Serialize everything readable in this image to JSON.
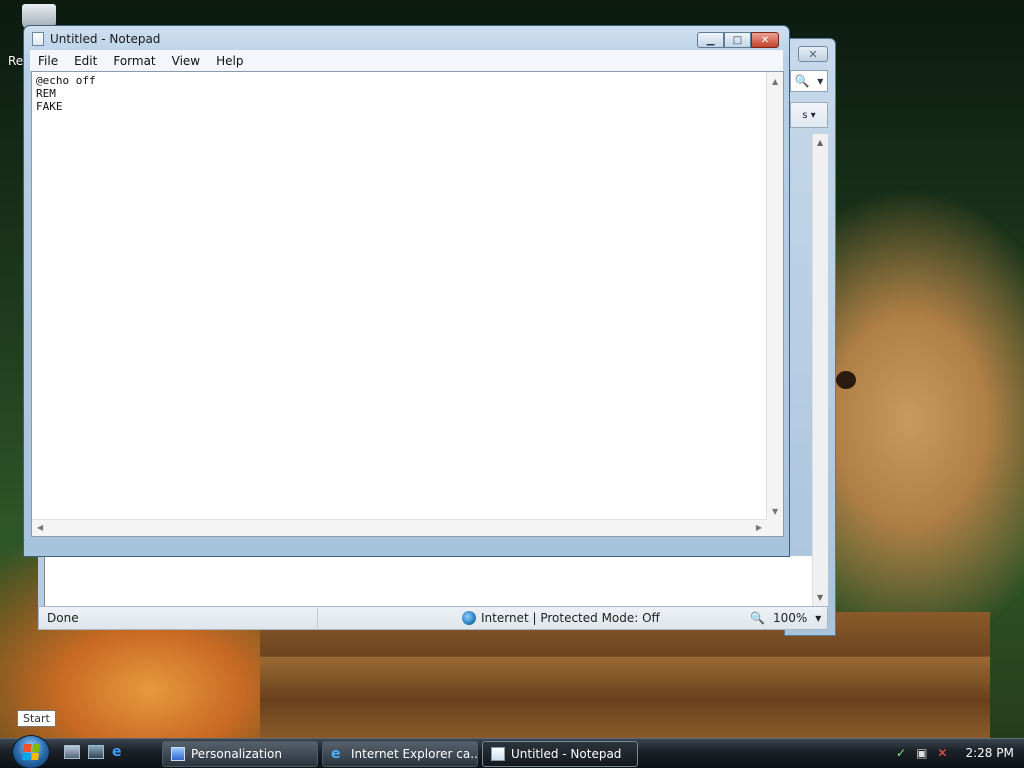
{
  "desktop": {
    "recycle_label": "Re"
  },
  "browser": {
    "close_glyph": "✕",
    "search_glyph": "🔍",
    "dropdown_glyph": "▾",
    "tools_truncated": "s ▾",
    "status": {
      "text": "Done",
      "zone": "Internet | Protected Mode: Off",
      "zoom": "100%"
    }
  },
  "notepad": {
    "title": "Untitled - Notepad",
    "menu": [
      "File",
      "Edit",
      "Format",
      "View",
      "Help"
    ],
    "content_line1": "@echo off",
    "content_line2": "REM",
    "content_line3": "FAKE"
  },
  "tooltip": {
    "text": "Start"
  },
  "taskbar": {
    "items": [
      {
        "label": "Personalization"
      },
      {
        "label": "Internet Explorer ca..."
      },
      {
        "label": "Untitled - Notepad"
      }
    ],
    "clock": "2:28 PM"
  },
  "colors": {
    "accent": "#2b6fb0",
    "taskbar": "#1b2229",
    "close_red": "#c2432a"
  }
}
